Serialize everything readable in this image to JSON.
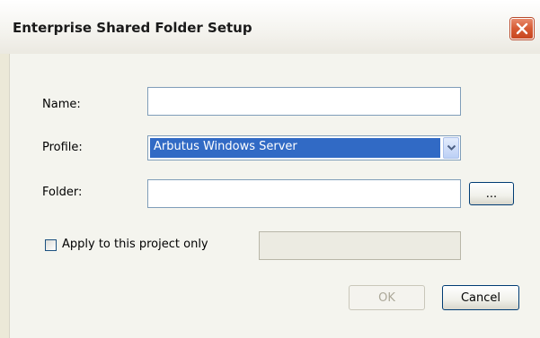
{
  "window": {
    "title": "Enterprise Shared Folder Setup",
    "close_icon": "close-icon"
  },
  "form": {
    "name_label": "Name:",
    "name_value": "",
    "profile_label": "Profile:",
    "profile_selected": "Arbutus Windows Server",
    "folder_label": "Folder:",
    "folder_value": "",
    "browse_label": "...",
    "apply_label": "Apply to this project only",
    "apply_checked": false,
    "project_value": ""
  },
  "buttons": {
    "ok_label": "OK",
    "cancel_label": "Cancel"
  }
}
